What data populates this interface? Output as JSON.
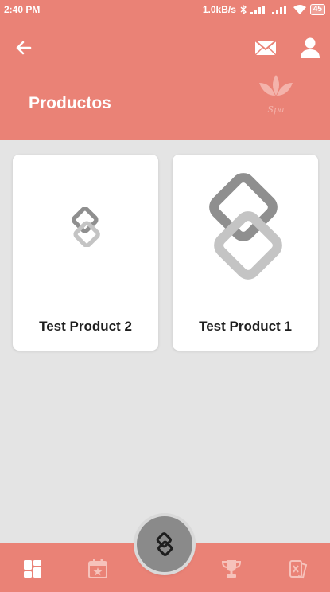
{
  "status_bar": {
    "time": "2:40 PM",
    "network_speed": "1.0kB/s",
    "battery": "45"
  },
  "header": {
    "title": "Productos",
    "logo_text": "Spa",
    "back_icon": "arrow-left-icon",
    "mail_icon": "mail-icon",
    "user_icon": "user-icon"
  },
  "products": [
    {
      "name": "Test Product 2",
      "image_icon": "chain-link-logo-icon"
    },
    {
      "name": "Test Product 1",
      "image_icon": "chain-link-logo-icon"
    }
  ],
  "bottom_nav": {
    "items": [
      {
        "icon": "dashboard-icon"
      },
      {
        "icon": "calendar-star-icon"
      },
      {
        "icon": "trophy-icon"
      },
      {
        "icon": "coupon-icon"
      }
    ],
    "fab_icon": "app-logo-icon"
  },
  "colors": {
    "primary": "#ea8276",
    "background": "#e4e4e4",
    "card": "#ffffff",
    "fab": "#8a8a8a"
  }
}
